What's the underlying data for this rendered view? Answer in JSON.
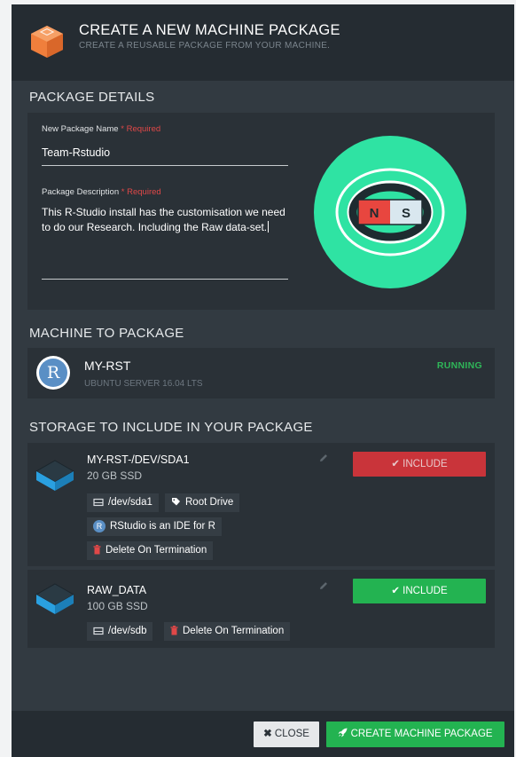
{
  "header": {
    "title": "CREATE A NEW MACHINE PACKAGE",
    "subtitle": "CREATE A REUSABLE PACKAGE FROM YOUR MACHINE.",
    "icon": "package-box-icon"
  },
  "package_details": {
    "section_title": "PACKAGE DETAILS",
    "name_label": "New Package Name",
    "required_text": "* Required",
    "name_value": "Team-Rstudio",
    "desc_label": "Package Description",
    "desc_value": "This R-Studio install has the customisation we need to do our Research. Including the Raw data-set.",
    "illustration": {
      "north_label": "N",
      "south_label": "S",
      "circle_color": "#2fe3a3",
      "north_color": "#e8463f"
    }
  },
  "machine": {
    "section_title": "MACHINE TO PACKAGE",
    "avatar_letter": "R",
    "name": "MY-RST",
    "os": "UBUNTU SERVER 16.04 LTS",
    "status": "RUNNING",
    "status_color": "#2fb658"
  },
  "storage": {
    "section_title": "STORAGE TO INCLUDE IN YOUR PACKAGE",
    "disks": [
      {
        "name": "MY-RST-/DEV/SDA1",
        "size": "20 GB SSD",
        "include_label": "INCLUDE",
        "include_color": "#c9343a",
        "tags": {
          "device": "/dev/sda1",
          "role": "Root Drive",
          "app_initial": "R",
          "app_desc": "RStudio is an IDE for R",
          "termination": "Delete On Termination"
        }
      },
      {
        "name": "RAW_DATA",
        "size": "100 GB SSD",
        "include_label": "INCLUDE",
        "include_color": "#23b351",
        "tags": {
          "device": "/dev/sdb",
          "termination": "Delete On Termination"
        }
      }
    ]
  },
  "footer": {
    "close_label": "CLOSE",
    "create_label": "CREATE MACHINE PACKAGE"
  }
}
